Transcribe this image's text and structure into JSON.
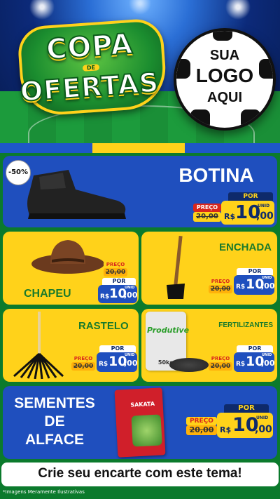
{
  "hero": {
    "title_line1": "COPA",
    "title_de": "DE",
    "title_line2": "OFERTAS",
    "logo_placeholder": [
      "SUA",
      "LOGO",
      "AQUI"
    ]
  },
  "products": [
    {
      "name": "BOTINA",
      "discount": "-50%",
      "preco_label": "PREÇO",
      "por_label": "POR",
      "old_price": "20,00",
      "currency": "R$",
      "price_int": "10",
      "price_cents": ",00",
      "unit": "UNID"
    },
    {
      "name": "CHAPEU",
      "preco_label": "PREÇO",
      "por_label": "POR",
      "old_price": "20,00",
      "currency": "R$",
      "price_int": "10",
      "price_cents": ",00",
      "unit": "UNID"
    },
    {
      "name": "ENCHADA",
      "preco_label": "PREÇO",
      "por_label": "POR",
      "old_price": "20,00",
      "currency": "R$",
      "price_int": "10",
      "price_cents": ",00",
      "unit": "UNID"
    },
    {
      "name": "RASTELO",
      "preco_label": "PREÇO",
      "por_label": "POR",
      "old_price": "20,00",
      "currency": "R$",
      "price_int": "10",
      "price_cents": ",00",
      "unit": "UNID"
    },
    {
      "name": "FERTILIZANTES",
      "package_brand": "Produtive",
      "package_weight": "50kg",
      "preco_label": "PREÇO",
      "por_label": "POR",
      "old_price": "20,00",
      "currency": "R$",
      "price_int": "10",
      "price_cents": ",00",
      "unit": "UNID"
    },
    {
      "name_lines": [
        "SEMENTES",
        "DE",
        "ALFACE"
      ],
      "package_brand": "SAKATA",
      "preco_label": "PREÇO",
      "por_label": "POR",
      "old_price": "20,00",
      "currency": "R$",
      "price_int": "10",
      "price_cents": ",00",
      "unit": "UNID"
    }
  ],
  "footer": {
    "cta": "Crie seu encarte com este tema!",
    "disclaimer": "*Imagens Meramente Ilustrativas"
  },
  "colors": {
    "blue": "#1f4fbe",
    "yellow": "#ffd21a",
    "green": "#0b7a2c",
    "red": "#d9261c",
    "navy": "#0e2a6b"
  }
}
